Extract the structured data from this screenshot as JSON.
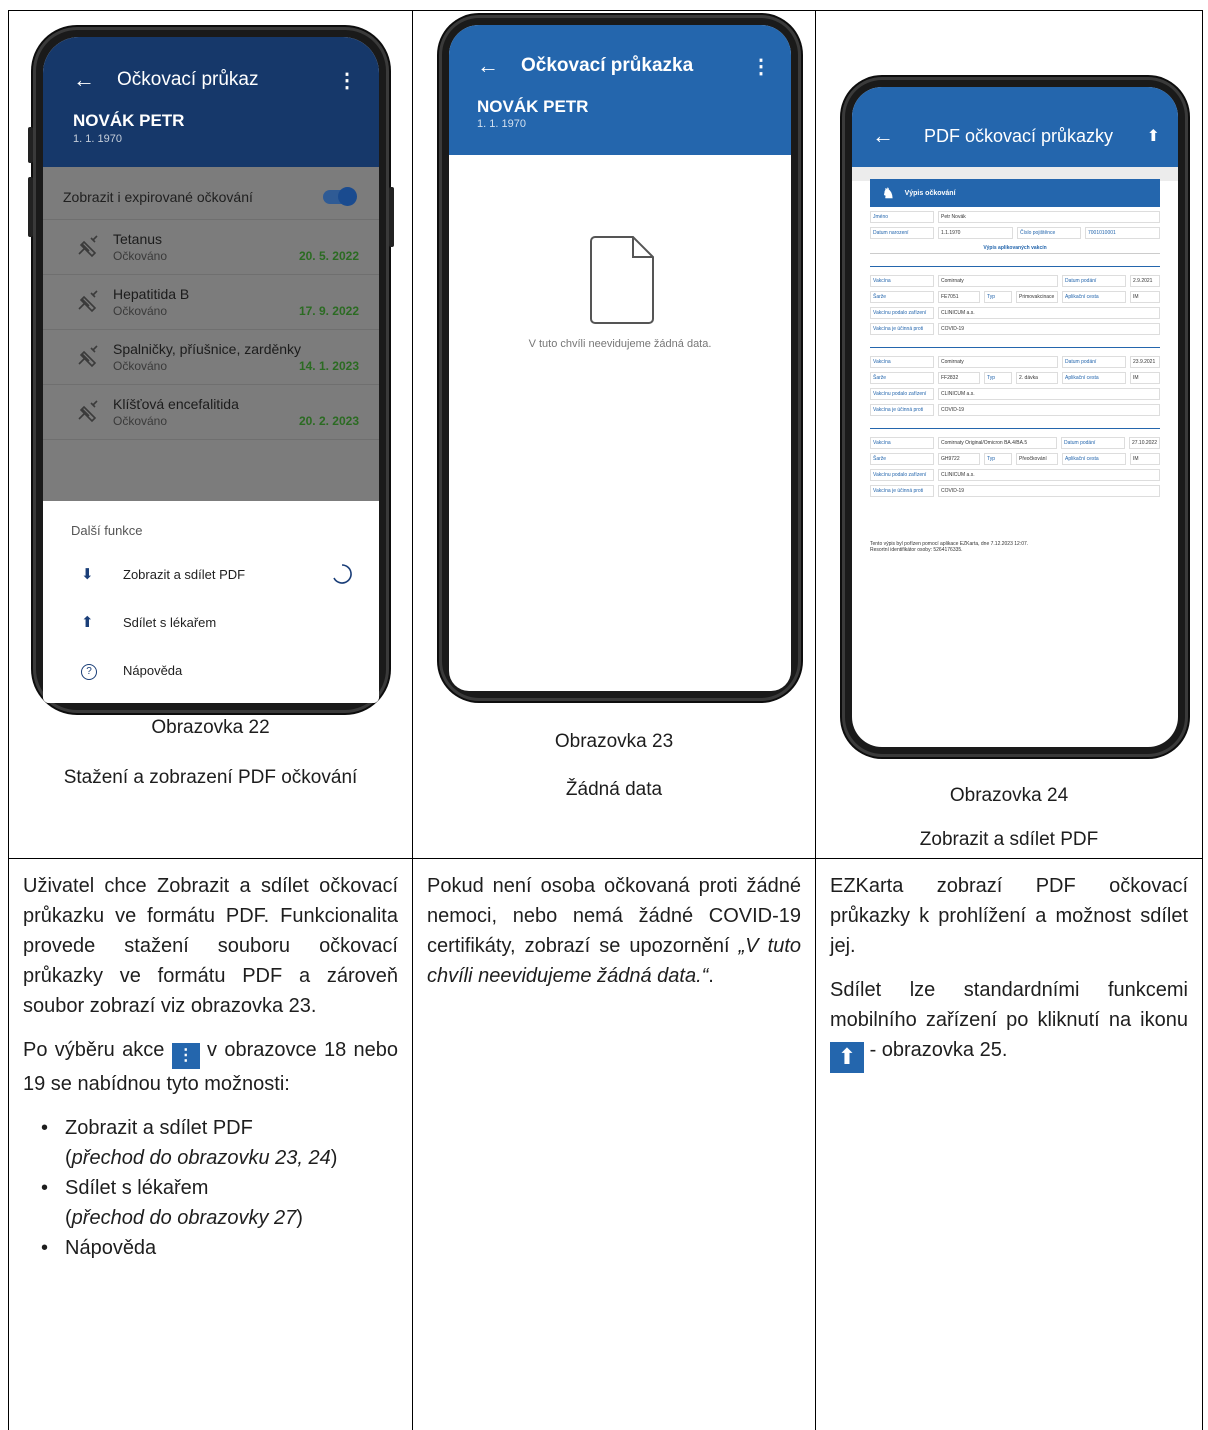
{
  "screen22": {
    "title": "Očkovací průkaz",
    "name": "NOVÁK PETR",
    "dob": "1. 1. 1970",
    "toggle_label": "Zobrazit i expirované očkování",
    "vaccinations": [
      {
        "name": "Tetanus",
        "status": "Očkováno",
        "date": "20. 5. 2022"
      },
      {
        "name": "Hepatitida B",
        "status": "Očkováno",
        "date": "17. 9. 2022"
      },
      {
        "name": "Spalničky, příušnice, zarděnky",
        "status": "Očkováno",
        "date": "14. 1. 2023"
      },
      {
        "name": "Klíšťová encefalitida",
        "status": "Očkováno",
        "date": "20. 2. 2023"
      }
    ],
    "sheet_title": "Další funkce",
    "menu": [
      {
        "icon": "download-icon",
        "label": "Zobrazit a sdílet PDF"
      },
      {
        "icon": "upload-icon",
        "label": "Sdílet s lékařem"
      },
      {
        "icon": "help-icon",
        "label": "Nápověda"
      }
    ],
    "caption1": "Obrazovka 22",
    "caption2": "Stažení a zobrazení PDF očkování"
  },
  "screen23": {
    "title": "Očkovací průkazka",
    "name": "NOVÁK PETR",
    "dob": "1. 1. 1970",
    "empty_text": "V tuto chvíli neevidujeme žádná data.",
    "caption1": "Obrazovka 23",
    "caption2": "Žádná data"
  },
  "screen24": {
    "title": "PDF očkovací průkazky",
    "pdf": {
      "header": "Výpis očkování",
      "name_label": "Jméno",
      "name_value": "Petr Novák",
      "dob_label": "Datum narození",
      "dob_value": "1.1.1970",
      "ins_label": "Číslo pojištěnce",
      "ins_value": "7001010001",
      "subheader": "Výpis aplikovaných vakcín",
      "entries": [
        {
          "vaccine": "Comirnaty",
          "date": "2.9.2021",
          "batch": "FE7051",
          "type": "Primovakcinace",
          "route": "IM",
          "facility": "CLINICUM a.s.",
          "against": "COVID-19"
        },
        {
          "vaccine": "Comirnaty",
          "date": "23.9.2021",
          "batch": "FF2832",
          "type": "2. dávka",
          "route": "IM",
          "facility": "CLINICUM a.s.",
          "against": "COVID-19"
        },
        {
          "vaccine": "Comirnaty Original/Omicron BA.4/BA.5",
          "date": "27.10.2022",
          "batch": "GH9722",
          "type": "Přeočkování",
          "route": "IM",
          "facility": "CLINICUM a.s.",
          "against": "COVID-19"
        }
      ],
      "labels": {
        "vaccine": "Vakcína",
        "date": "Datum podání",
        "batch": "Šarže",
        "type": "Typ",
        "route": "Aplikační cesta",
        "facility": "Vakcínu podalo zařízení",
        "against": "Vakcína je účinná proti"
      },
      "footer1": "Tento výpis byl pořízen pomocí aplikace EZKarta, dne 7.12.2023 12:07.",
      "footer2": "Resortní identifikátor osoby: 5264176335."
    },
    "caption1": "Obrazovka 24",
    "caption2": "Zobrazit a sdílet PDF"
  },
  "desc1": {
    "p1": "Uživatel chce Zobrazit a sdílet očkovací průkazku ve formátu PDF. Funkcionalita provede stažení souboru očkovací průkazky ve formátu PDF a zároveň soubor zobrazí viz obrazovka 23.",
    "p2a": "Po výběru akce",
    "p2b": "v obrazovce 18 nebo 19 se nabídnou tyto možnosti:",
    "b1": "Zobrazit a sdílet PDF",
    "b1i": "přechod do obrazovku 23, 24",
    "b2": "Sdílet s lékařem",
    "b2i": "přechod do obrazovky 27",
    "b3": "Nápověda"
  },
  "desc2": {
    "p1": "Pokud není osoba očkovaná proti žádné nemoci, nebo nemá žádné COVID-19 certifikáty, zobrazí se upozornění",
    "p1i": "„V tuto chvíli neevidujeme žádná data.“",
    "p1end": "."
  },
  "desc3": {
    "p1": "EZKarta zobrazí PDF očkovací průkazky k prohlížení a možnost sdílet jej.",
    "p2a": "Sdílet lze standardními funkcemi mobilního zařízení po kliknutí na ikonu",
    "p2b": "- obrazovka 25."
  }
}
